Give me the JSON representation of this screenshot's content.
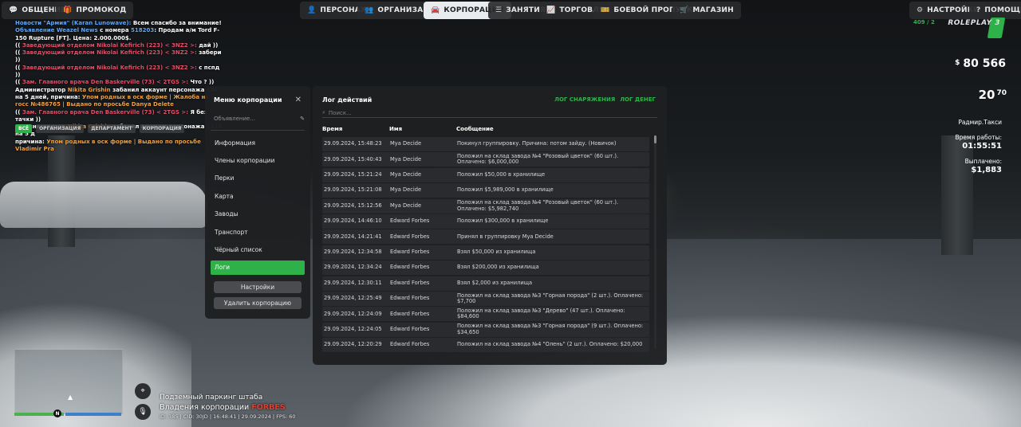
{
  "topbar": {
    "left": [
      {
        "label": "ОБЩЕНИЕ",
        "icon": "chat-icon"
      },
      {
        "label": "ПРОМОКОД",
        "icon": "gift-icon"
      }
    ],
    "center": [
      {
        "label": "ПЕРСОНАЖ",
        "icon": "person-icon"
      },
      {
        "label": "ОРГАНИЗАЦИЯ",
        "icon": "users-icon"
      },
      {
        "label": "КОРПОРАЦИЯ",
        "icon": "car-icon",
        "active": true
      },
      {
        "label": "ЗАНЯТИЯ",
        "icon": "list-icon"
      },
      {
        "label": "ТОРГОВЛЯ",
        "icon": "chart-icon"
      },
      {
        "label": "БОЕВОЙ ПРОПУСК",
        "icon": "ticket-icon"
      },
      {
        "label": "МАГАЗИН",
        "icon": "cart-icon"
      }
    ],
    "right": [
      {
        "label": "НАСТРОЙКИ",
        "icon": "gear-icon"
      },
      {
        "label": "ПОМОЩЬ",
        "icon": "help-icon"
      }
    ]
  },
  "chat": {
    "lines": [
      [
        {
          "t": "Новости \"Армия\" (Karan Lunowave): ",
          "c": "c-blue"
        },
        {
          "t": "Всем спасибо за внимание!",
          "c": "c-w"
        }
      ],
      [
        {
          "t": "Объявление Weazel News ",
          "c": "c-blue"
        },
        {
          "t": "с номера ",
          "c": "c-w"
        },
        {
          "t": "518203",
          "c": "c-blue"
        },
        {
          "t": ": Продам а/м Tord F-150 Rupture [FT]. Цена: 2.000.000$.",
          "c": "c-w"
        }
      ],
      [
        {
          "t": "(( ",
          "c": "c-w"
        },
        {
          "t": "Заведующий отделом Nikolai Kefirich (223) < 3NZ2 >:",
          "c": "c-red"
        },
        {
          "t": " дай ))",
          "c": "c-w"
        }
      ],
      [
        {
          "t": "(( ",
          "c": "c-w"
        },
        {
          "t": "Заведующий отделом Nikolai Kefirich (223) < 3NZ2 >:",
          "c": "c-red"
        },
        {
          "t": " забери ))",
          "c": "c-w"
        }
      ],
      [
        {
          "t": "(( ",
          "c": "c-w"
        },
        {
          "t": "Заведующий отделом Nikolai Kefirich (223) < 3NZ2 >:",
          "c": "c-red"
        },
        {
          "t": " с пспд ))",
          "c": "c-w"
        }
      ],
      [
        {
          "t": "(( ",
          "c": "c-w"
        },
        {
          "t": "Зам. Главного врача Den Baskerville (73) < 2TGS >:",
          "c": "c-red"
        },
        {
          "t": " Что ? ))",
          "c": "c-w"
        }
      ],
      [
        {
          "t": "Администратор ",
          "c": "c-w"
        },
        {
          "t": "Nikita Grishin",
          "c": "c-or"
        },
        {
          "t": " забанил аккаунт персонажа ",
          "c": "c-w"
        },
        {
          "t": "CAP",
          "c": "c-blue"
        },
        {
          "t": " на 5 дней, причина: ",
          "c": "c-w"
        },
        {
          "t": "Упом родных в оск форме | Жалоба на госс №486765 | Выдано по просьбе Danya Delete",
          "c": "c-or"
        }
      ],
      [
        {
          "t": "(( ",
          "c": "c-w"
        },
        {
          "t": "Зам. Главного врача Den Baskerville (73) < 2TGS >:",
          "c": "c-red"
        },
        {
          "t": " Я без тачки ))",
          "c": "c-w"
        }
      ],
      [
        {
          "t": "Администратор ",
          "c": "c-w"
        },
        {
          "t": "Nikita Grishin",
          "c": "c-or"
        },
        {
          "t": " забанил аккаунт персонажа ",
          "c": "c-w"
        },
        {
          "t": "2118",
          "c": "c-blue"
        },
        {
          "t": " на 5 д",
          "c": "c-w"
        }
      ],
      [
        {
          "t": "причина: ",
          "c": "c-w"
        },
        {
          "t": "Упом родных в оск форме | Выдано по просьбе Vladimir Pra",
          "c": "c-or"
        }
      ]
    ],
    "tabs": [
      {
        "label": "ВСЁ",
        "active": true
      },
      {
        "label": "ОРГАНИЗАЦИЯ"
      },
      {
        "label": "ДЕПАРТАМЕНТ"
      },
      {
        "label": "КОРПОРАЦИЯ"
      }
    ]
  },
  "menu": {
    "title": "Меню корпорации",
    "announcement_placeholder": "Объявление...",
    "items": [
      {
        "label": "Информация"
      },
      {
        "label": "Члены корпорации"
      },
      {
        "label": "Перки"
      },
      {
        "label": "Карта"
      },
      {
        "label": "Заводы"
      },
      {
        "label": "Транспорт"
      },
      {
        "label": "Чёрный список"
      },
      {
        "label": "Логи",
        "active": true
      }
    ],
    "settings_label": "Настройки",
    "delete_label": "Удалить корпорацию"
  },
  "log": {
    "title": "Лог действий",
    "link_equipment": "ЛОГ СНАРЯЖЕНИЯ",
    "link_money": "ЛОГ ДЕНЕГ",
    "search_placeholder": "Поиск...",
    "columns": {
      "time": "Время",
      "name": "Имя",
      "message": "Сообщение"
    },
    "rows": [
      {
        "time": "29.09.2024, 15:48:23",
        "name": "Mya Decide",
        "message": "Покинул группировку. Причина: потом зайду. (Новичок)"
      },
      {
        "time": "29.09.2024, 15:40:43",
        "name": "Mya Decide",
        "message": "Положил на склад завода №4 \"Розовый цветок\" (60 шт.). Оплачено: $6,000,000"
      },
      {
        "time": "29.09.2024, 15:21:24",
        "name": "Mya Decide",
        "message": "Положил $50,000 в хранилище"
      },
      {
        "time": "29.09.2024, 15:21:08",
        "name": "Mya Decide",
        "message": "Положил $5,989,000 в хранилище"
      },
      {
        "time": "29.09.2024, 15:12:56",
        "name": "Mya Decide",
        "message": "Положил на склад завода №4 \"Розовый цветок\" (60 шт.). Оплачено: $5,982,740"
      },
      {
        "time": "29.09.2024, 14:46:10",
        "name": "Edward Forbes",
        "message": "Положил $300,000 в хранилище"
      },
      {
        "time": "29.09.2024, 14:21:41",
        "name": "Edward Forbes",
        "message": "Принял в группировку Mya Decide"
      },
      {
        "time": "29.09.2024, 12:34:58",
        "name": "Edward Forbes",
        "message": "Взял $50,000 из хранилища"
      },
      {
        "time": "29.09.2024, 12:34:24",
        "name": "Edward Forbes",
        "message": "Взял $200,000 из хранилища"
      },
      {
        "time": "29.09.2024, 12:30:11",
        "name": "Edward Forbes",
        "message": "Взял $2,000 из хранилища"
      },
      {
        "time": "29.09.2024, 12:25:49",
        "name": "Edward Forbes",
        "message": "Положил на склад завода №3 \"Горная порода\" (2 шт.). Оплачено: $7,700"
      },
      {
        "time": "29.09.2024, 12:24:09",
        "name": "Edward Forbes",
        "message": "Положил на склад завода №3 \"Дерево\" (47 шт.). Оплачено: $84,600"
      },
      {
        "time": "29.09.2024, 12:24:05",
        "name": "Edward Forbes",
        "message": "Положил на склад завода №3 \"Горная порода\" (9 шт.). Оплачено: $34,650"
      },
      {
        "time": "29.09.2024, 12:20:29",
        "name": "Edward Forbes",
        "message": "Положил на склад завода №4 \"Олень\" (2 шт.). Оплачено: $20,000"
      }
    ]
  },
  "hud": {
    "online": "409 / 2",
    "logo": "ROLEPLAY",
    "logo_number": "3",
    "money": "80 566",
    "money_sign": "$",
    "ammo_main": "20",
    "ammo_sub": "70",
    "job": "Радмир.Такси",
    "work_time_label": "Время работы:",
    "work_time": "01:55:51",
    "payout_label": "Выплачено:",
    "payout": "$1,883",
    "location": "Подземный паркинг штаба",
    "territory_prefix": "Владения корпорации",
    "territory_corp": "FORBES",
    "status_line": "ID: 385 | CID: 30JD | 16:48:41 | 29.09.2024 | FPS: 60",
    "compass": "N",
    "health_fraction": 0.46,
    "armor_fraction": 0.54
  }
}
